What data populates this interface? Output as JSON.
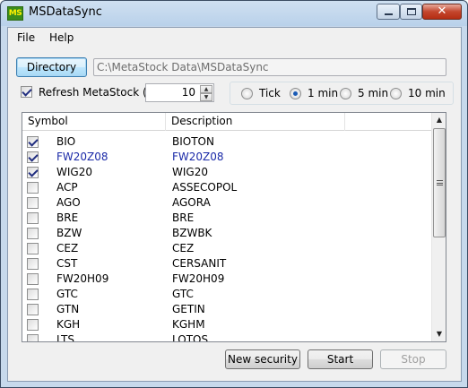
{
  "window": {
    "app_icon_text": "MS",
    "title": "MSDataSync",
    "controls": {
      "minimize": "",
      "maximize": "",
      "close": "✕"
    }
  },
  "menu": {
    "items": [
      "File",
      "Help"
    ]
  },
  "directory": {
    "button_label": "Directory",
    "path": "C:\\MetaStock Data\\MSDataSync"
  },
  "refresh": {
    "checked": true,
    "label": "Refresh MetaStock (s)",
    "value": "10"
  },
  "interval": {
    "options": [
      "Tick",
      "1 min",
      "5 min",
      "10 min"
    ],
    "selected": "1 min"
  },
  "table": {
    "columns": [
      "Symbol",
      "Description"
    ],
    "rows": [
      {
        "checked": true,
        "symbol": "BIO",
        "description": "BIOTON",
        "highlight": false
      },
      {
        "checked": true,
        "symbol": "FW20Z08",
        "description": "FW20Z08",
        "highlight": true
      },
      {
        "checked": true,
        "symbol": "WIG20",
        "description": "WIG20",
        "highlight": false
      },
      {
        "checked": false,
        "symbol": "ACP",
        "description": "ASSECOPOL",
        "highlight": false
      },
      {
        "checked": false,
        "symbol": "AGO",
        "description": "AGORA",
        "highlight": false
      },
      {
        "checked": false,
        "symbol": "BRE",
        "description": "BRE",
        "highlight": false
      },
      {
        "checked": false,
        "symbol": "BZW",
        "description": "BZWBK",
        "highlight": false
      },
      {
        "checked": false,
        "symbol": "CEZ",
        "description": "CEZ",
        "highlight": false
      },
      {
        "checked": false,
        "symbol": "CST",
        "description": "CERSANIT",
        "highlight": false
      },
      {
        "checked": false,
        "symbol": "FW20H09",
        "description": "FW20H09",
        "highlight": false
      },
      {
        "checked": false,
        "symbol": "GTC",
        "description": "GTC",
        "highlight": false
      },
      {
        "checked": false,
        "symbol": "GTN",
        "description": "GETIN",
        "highlight": false
      },
      {
        "checked": false,
        "symbol": "KGH",
        "description": "KGHM",
        "highlight": false
      },
      {
        "checked": false,
        "symbol": "LTS",
        "description": "LOTOS",
        "highlight": false
      }
    ]
  },
  "scrollbar": {
    "up_arrow": "▲",
    "down_arrow": "▼"
  },
  "buttons": {
    "new_security": "New security",
    "start": "Start",
    "stop": "Stop"
  },
  "colors": {
    "highlight_text": "#1b2aa8",
    "title_bar": "#b9d1ea",
    "app_icon_bg": "#3a8c1c"
  }
}
